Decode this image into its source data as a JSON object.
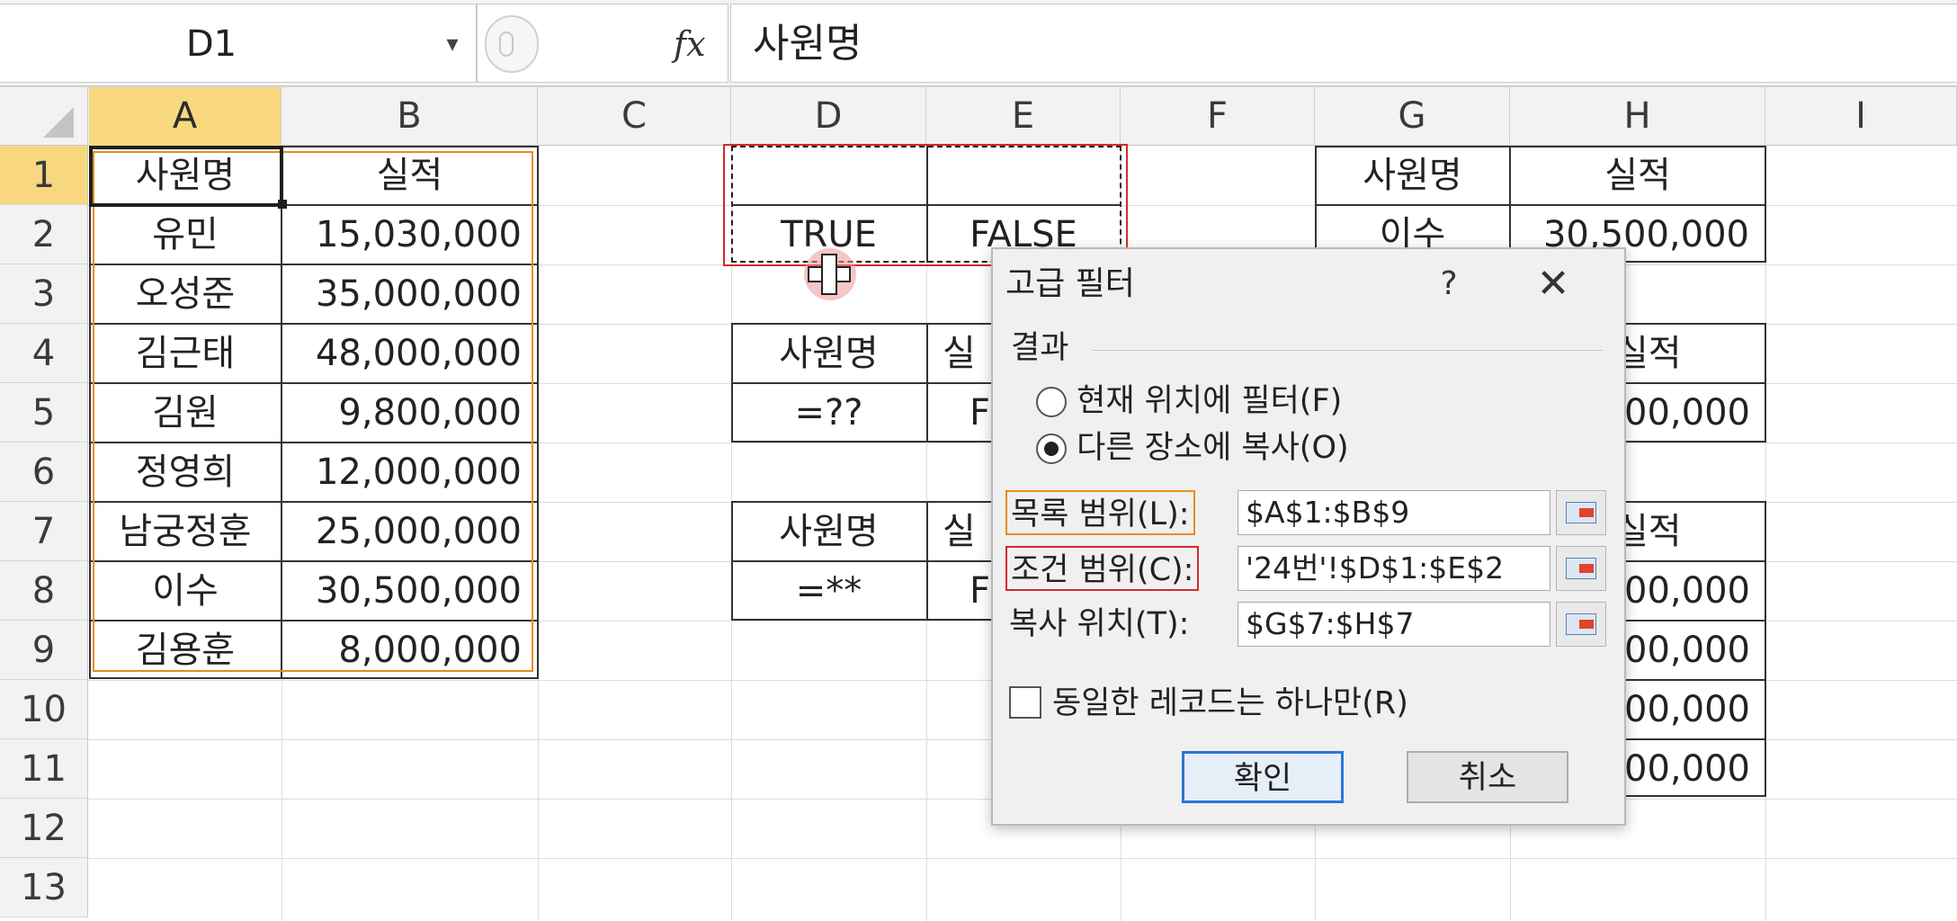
{
  "formula_bar": {
    "name_box": "D1",
    "fx_label": "fx",
    "formula": "사원명"
  },
  "columns": [
    "A",
    "B",
    "C",
    "D",
    "E",
    "F",
    "G",
    "H",
    "I"
  ],
  "rows": [
    "1",
    "2",
    "3",
    "4",
    "5",
    "6",
    "7",
    "8",
    "9",
    "10",
    "11",
    "12",
    "13"
  ],
  "list_table": {
    "headers": [
      "사원명",
      "실적"
    ],
    "rows": [
      [
        "유민",
        "15,030,000"
      ],
      [
        "오성준",
        "35,000,000"
      ],
      [
        "김근태",
        "48,000,000"
      ],
      [
        "김원",
        "9,800,000"
      ],
      [
        "정영희",
        "12,000,000"
      ],
      [
        "남궁정훈",
        "25,000,000"
      ],
      [
        "이수",
        "30,500,000"
      ],
      [
        "김용훈",
        "8,000,000"
      ]
    ]
  },
  "criteria_d": {
    "d2": "TRUE",
    "e2": "FALSE"
  },
  "criteria_4": {
    "header": "사원명",
    "header2_partial": "실",
    "value": "=??",
    "value2_partial": "F"
  },
  "criteria_7": {
    "header": "사원명",
    "header2_partial": "실",
    "value": "=**",
    "value2_partial": "F"
  },
  "result_g1": {
    "headers": [
      "사원명",
      "실적"
    ],
    "row": [
      "이수",
      "30,500,000"
    ]
  },
  "result_h4": {
    "header_partial": "실적",
    "value_partial": "00,000"
  },
  "result_h7": {
    "header_partial": "실적",
    "values_partial": [
      "00,000",
      "00,000",
      "00,000",
      "00,000"
    ]
  },
  "dialog": {
    "title": "고급 필터",
    "help": "?",
    "close": "✕",
    "group_label": "결과",
    "radio_in_place": "현재 위치에 필터(F)",
    "radio_copy": "다른 장소에 복사(O)",
    "list_range_label": "목록 범위(L):",
    "list_range_value": "$A$1:$B$9",
    "criteria_range_label": "조건 범위(C):",
    "criteria_range_value": "'24번'!$D$1:$E$2",
    "copy_to_label": "복사 위치(T):",
    "copy_to_value": "$G$7:$H$7",
    "unique_label": "동일한 레코드는 하나만(R)",
    "ok_label": "확인",
    "cancel_label": "취소"
  }
}
